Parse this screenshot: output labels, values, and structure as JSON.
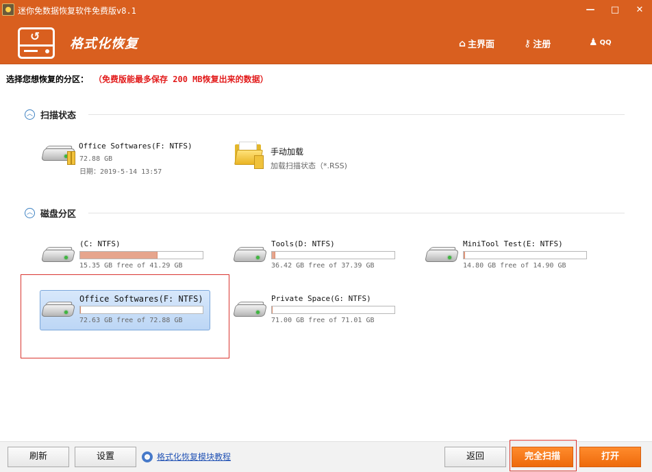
{
  "window": {
    "title": "迷你免数据恢复软件免费版v8.1",
    "minimize": "—",
    "maximize": "□",
    "close": "✕"
  },
  "header": {
    "mode_title": "格式化恢复",
    "nav": [
      {
        "label": "主界面",
        "icon": "home-icon"
      },
      {
        "label": "注册",
        "icon": "key-icon"
      },
      {
        "label": "QQ",
        "icon": "qq-icon"
      }
    ]
  },
  "notice": {
    "label": "选择您想恢复的分区：",
    "warning": "（免费版能最多保存 200 MB恢复出来的数据）"
  },
  "sections": {
    "scan_state": "扫描状态",
    "disk_partitions": "磁盘分区"
  },
  "scan_states": [
    {
      "name": "Office Softwares(F: NTFS)",
      "size": "72.88 GB",
      "date": "日期：2019-5-14 13:57"
    }
  ],
  "manual_load": {
    "title": "手动加载",
    "subtitle": "加载扫描状态（*.RSS)"
  },
  "partitions": [
    {
      "name": "(C: NTFS)",
      "info": "15.35 GB free of 41.29 GB",
      "used_fraction": 0.63
    },
    {
      "name": "Tools(D: NTFS)",
      "info": "36.42 GB free of 37.39 GB",
      "used_fraction": 0.03
    },
    {
      "name": "MiniTool Test(E: NTFS)",
      "info": "14.80 GB free of 14.90 GB",
      "used_fraction": 0.01
    },
    {
      "name": "Office Softwares(F: NTFS)",
      "info": "72.63 GB free of 72.88 GB",
      "used_fraction": 0.004,
      "selected": true
    },
    {
      "name": "Private Space(G: NTFS)",
      "info": "71.00 GB free of 71.01 GB",
      "used_fraction": 0.001
    }
  ],
  "footer": {
    "refresh": "刷新",
    "settings": "设置",
    "tutorial_link": "格式化恢复模块教程",
    "back": "返回",
    "full_scan": "完全扫描",
    "open": "打开"
  },
  "colors": {
    "header": "#d95f1f",
    "warning": "#e21b1b",
    "bar_fill": "#e6a58d",
    "primary_button": "#ee6a0c",
    "highlight": "#d9322d",
    "selection": "#bcd6f5"
  }
}
